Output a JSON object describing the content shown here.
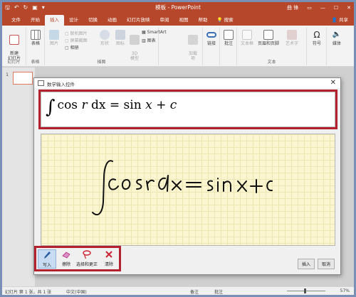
{
  "title_bar": {
    "doc_title": "模板 - PowerPoint",
    "user": "曲 锋",
    "save_icon": "save-icon",
    "undo_icon": "undo-icon",
    "redo_icon": "redo-icon",
    "start_icon": "present-from-start-icon",
    "customize": "▾"
  },
  "tabs": [
    "文件",
    "开始",
    "插入",
    "设计",
    "切换",
    "动画",
    "幻灯片放映",
    "审阅",
    "视图",
    "帮助"
  ],
  "active_tab": "插入",
  "search_label": "搜索",
  "share_label": "共享",
  "ribbon": {
    "new_slide": "新建\n幻灯片",
    "table": "表格",
    "image": "图片",
    "online_image": "联机图片",
    "screenshot": "屏幕截图",
    "album": "相册",
    "shapes": "形状",
    "icons": "图标",
    "model3d": "3D\n模型",
    "smartart": "SmartArt",
    "chart": "图表",
    "addins": "加载\n项",
    "link": "链接",
    "comment": "批注",
    "textbox": "文本框",
    "header_footer": "页眉和页脚",
    "wordart": "艺术字",
    "symbol": "符号",
    "media": "媒体",
    "groups": {
      "slides": "幻灯片",
      "tables": "表格",
      "illustrations": "插图",
      "text": "文本"
    }
  },
  "slide_number": "1",
  "dialog": {
    "title": "数学输入控件",
    "close": "✕",
    "formula_parts": {
      "integral": "∫",
      "cos": "cos",
      "r": "r",
      "d": "d",
      "x": "x",
      "eq": "=",
      "sin": "sin",
      "plus": "+",
      "c": "c"
    },
    "tools": [
      {
        "label": "写入",
        "icon": "pen-icon"
      },
      {
        "label": "擦除",
        "icon": "eraser-icon"
      },
      {
        "label": "选择和更正",
        "icon": "lasso-icon"
      },
      {
        "label": "清除",
        "icon": "clear-icon"
      }
    ],
    "insert_button": "插入",
    "cancel_button": "取消"
  },
  "status_bar": {
    "slide_info": "幻灯片 第 1 张，共 1 张",
    "language": "中文(中国)",
    "notes": "备注",
    "comments": "批注",
    "zoom": "57%"
  },
  "colors": {
    "accent": "#b7472a",
    "highlight_box": "#b3202e",
    "writepad": "#fbf6cf"
  }
}
